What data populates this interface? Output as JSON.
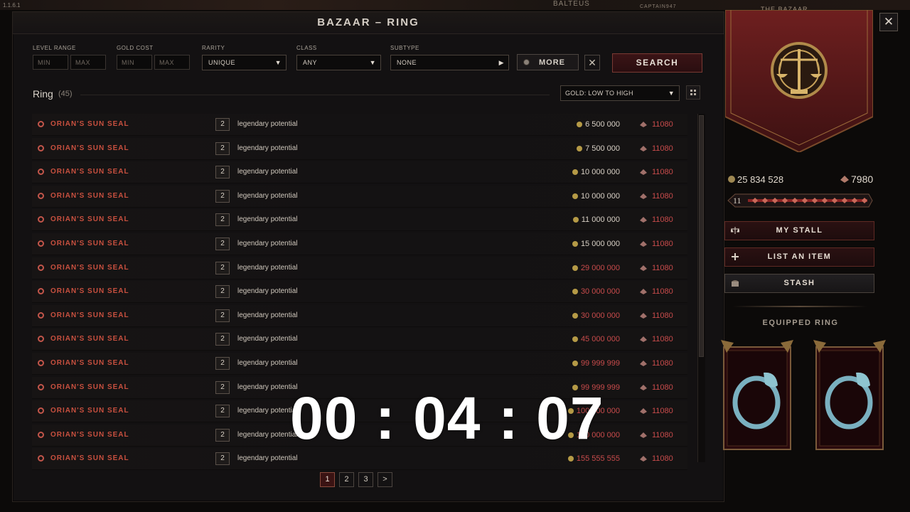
{
  "version": "1.1.6.1",
  "background_names": [
    "BALTEUS",
    "CAPTAIN947"
  ],
  "window": {
    "title": "BAZAAR –  RING"
  },
  "filters": {
    "level_range": {
      "label": "LEVEL RANGE",
      "min_placeholder": "MIN",
      "max_placeholder": "MAX"
    },
    "gold_cost": {
      "label": "GOLD COST",
      "min_placeholder": "MIN",
      "max_placeholder": "MAX"
    },
    "rarity": {
      "label": "RARITY",
      "value": "UNIQUE"
    },
    "class": {
      "label": "CLASS",
      "value": "ANY"
    },
    "subtype": {
      "label": "SUBTYPE",
      "value": "NONE"
    },
    "more_label": "MORE",
    "clear_label": "✕",
    "search_label": "SEARCH"
  },
  "list": {
    "title": "Ring",
    "count": "(45)",
    "sort_value": "GOLD: LOW TO HIGH"
  },
  "rows": [
    {
      "name": "ORIAN'S SUN SEAL",
      "lp": "2",
      "lp_text": "legendary potential",
      "price": "6 500 000",
      "price_color": "#d8d0c5",
      "favor": "11080"
    },
    {
      "name": "ORIAN'S SUN SEAL",
      "lp": "2",
      "lp_text": "legendary potential",
      "price": "7 500 000",
      "price_color": "#d8d0c5",
      "favor": "11080"
    },
    {
      "name": "ORIAN'S SUN SEAL",
      "lp": "2",
      "lp_text": "legendary potential",
      "price": "10 000 000",
      "price_color": "#d8d0c5",
      "favor": "11080"
    },
    {
      "name": "ORIAN'S SUN SEAL",
      "lp": "2",
      "lp_text": "legendary potential",
      "price": "10 000 000",
      "price_color": "#d8d0c5",
      "favor": "11080"
    },
    {
      "name": "ORIAN'S SUN SEAL",
      "lp": "2",
      "lp_text": "legendary potential",
      "price": "11 000 000",
      "price_color": "#d8d0c5",
      "favor": "11080"
    },
    {
      "name": "ORIAN'S SUN SEAL",
      "lp": "2",
      "lp_text": "legendary potential",
      "price": "15 000 000",
      "price_color": "#d8d0c5",
      "favor": "11080"
    },
    {
      "name": "ORIAN'S SUN SEAL",
      "lp": "2",
      "lp_text": "legendary potential",
      "price": "29 000 000",
      "price_color": "#c84b4b",
      "favor": "11080"
    },
    {
      "name": "ORIAN'S SUN SEAL",
      "lp": "2",
      "lp_text": "legendary potential",
      "price": "30 000 000",
      "price_color": "#c84b4b",
      "favor": "11080"
    },
    {
      "name": "ORIAN'S SUN SEAL",
      "lp": "2",
      "lp_text": "legendary potential",
      "price": "30 000 000",
      "price_color": "#c84b4b",
      "favor": "11080"
    },
    {
      "name": "ORIAN'S SUN SEAL",
      "lp": "2",
      "lp_text": "legendary potential",
      "price": "45 000 000",
      "price_color": "#c84b4b",
      "favor": "11080"
    },
    {
      "name": "ORIAN'S SUN SEAL",
      "lp": "2",
      "lp_text": "legendary potential",
      "price": "99 999 999",
      "price_color": "#c84b4b",
      "favor": "11080"
    },
    {
      "name": "ORIAN'S SUN SEAL",
      "lp": "2",
      "lp_text": "legendary potential",
      "price": "99 999 999",
      "price_color": "#c84b4b",
      "favor": "11080"
    },
    {
      "name": "ORIAN'S SUN SEAL",
      "lp": "2",
      "lp_text": "legendary potential",
      "price": "100 000 000",
      "price_color": "#c84b4b",
      "favor": "11080"
    },
    {
      "name": "ORIAN'S SUN SEAL",
      "lp": "2",
      "lp_text": "legendary potential",
      "price": "150 000 000",
      "price_color": "#c84b4b",
      "favor": "11080"
    },
    {
      "name": "ORIAN'S SUN SEAL",
      "lp": "2",
      "lp_text": "legendary potential",
      "price": "155 555 555",
      "price_color": "#c84b4b",
      "favor": "11080"
    }
  ],
  "pagination": {
    "pages": [
      "1",
      "2",
      "3"
    ],
    "current": "1",
    "next_label": ">"
  },
  "timer": "00 : 04 : 07",
  "sidebar": {
    "header_label": "THE BAZAAR",
    "gold": "25 834 528",
    "favor": "7980",
    "rank": "11",
    "my_stall_label": "MY STALL",
    "list_item_label": "LIST AN ITEM",
    "stash_label": "STASH",
    "equipped_label": "EQUIPPED RING"
  },
  "colors": {
    "item_unique": "#c8503f",
    "accent_red": "#c84b4b",
    "gold_coin": "#b59a46"
  }
}
